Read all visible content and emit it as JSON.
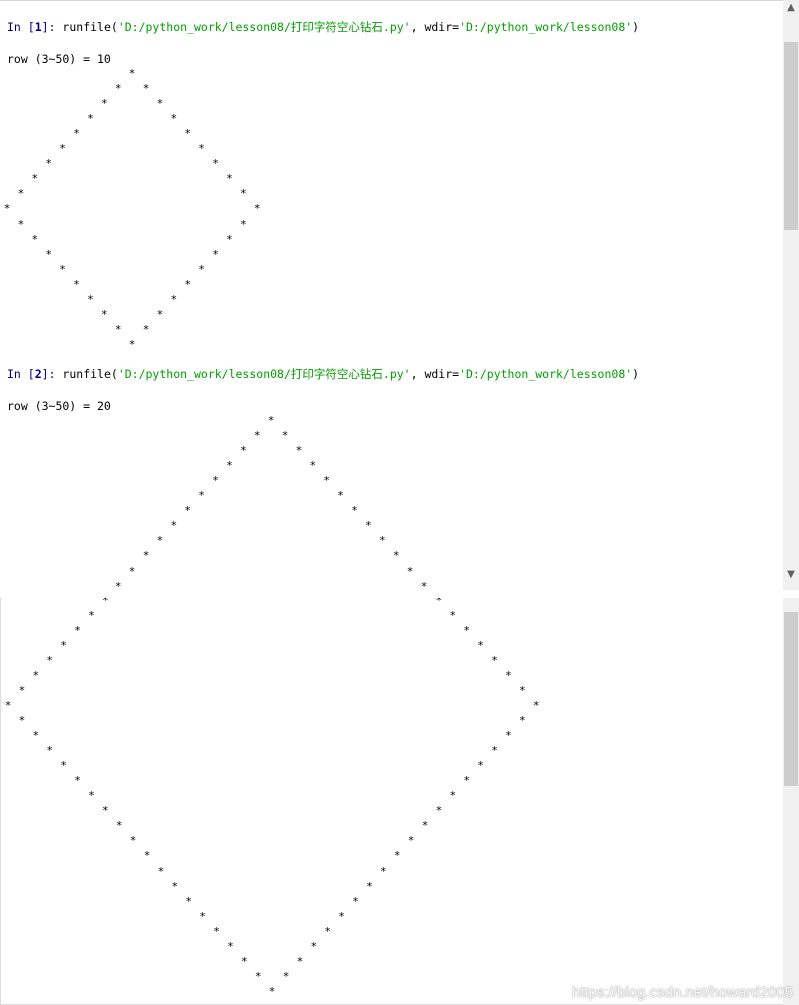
{
  "console": {
    "cells": [
      {
        "prompt_open": "In [",
        "prompt_num": "1",
        "prompt_close": "]: ",
        "call_prefix": "runfile(",
        "filepath": "'D:/python_work/lesson08/打印字符空心钻石.py'",
        "wdir_label": ", wdir=",
        "wdir_value": "'D:/python_work/lesson08'",
        "call_suffix": ")",
        "output_line": "row (3~50) = 10",
        "diamond_rows": 10
      },
      {
        "prompt_open": "In [",
        "prompt_num": "2",
        "prompt_close": "]: ",
        "call_prefix": "runfile(",
        "filepath": "'D:/python_work/lesson08/打印字符空心钻石.py'",
        "wdir_label": ", wdir=",
        "wdir_value": "'D:/python_work/lesson08'",
        "call_suffix": ")",
        "output_line": "row (3~50) = 20",
        "diamond_rows": 20
      }
    ],
    "star_char": "*"
  },
  "scrollbars": {
    "up_arrow": "▲",
    "down_arrow": "▼"
  },
  "watermark": "https://blog.csdn.net/howard2005",
  "colors": {
    "prompt": "#000080",
    "string": "#00a000",
    "text": "#000000",
    "scroll_track": "#f0f0f0",
    "scroll_thumb": "#cdcdcd"
  }
}
